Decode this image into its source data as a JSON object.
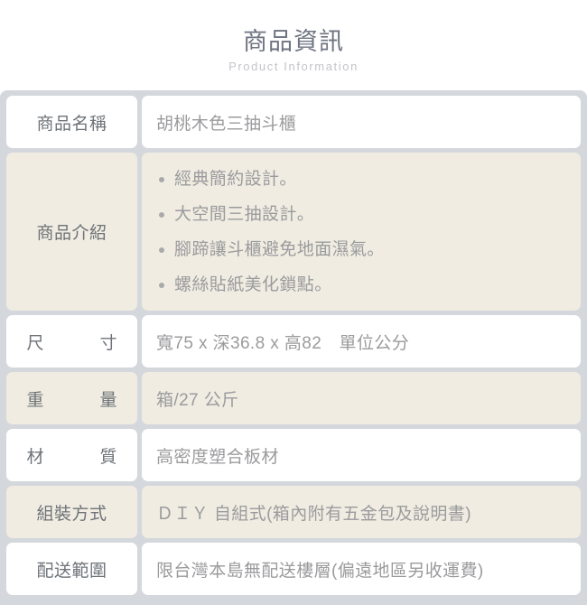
{
  "header": {
    "title": "商品資訊",
    "subtitle": "Product Information"
  },
  "colors": {
    "panel_background": "#d4d8dd",
    "cell_white": "#ffffff",
    "cell_beige": "#f0ece1",
    "label_text": "#6e7378",
    "value_text": "#9b9b9e",
    "title_text": "#6e7380",
    "subtitle_text": "#c3c4c9",
    "bullet": "#a9a9ac"
  },
  "table": {
    "rows": [
      {
        "label": "商品名稱",
        "value": "胡桃木色三抽斗櫃",
        "fill": "white",
        "label_spaced": false,
        "type": "text"
      },
      {
        "label": "商品介紹",
        "fill": "beige",
        "label_spaced": false,
        "type": "bullets",
        "bullets": [
          "經典簡約設計。",
          "大空間三抽設計。",
          "腳蹄讓斗櫃避免地面濕氣。",
          "螺絲貼紙美化鎖點。"
        ]
      },
      {
        "label": "尺寸",
        "value": "寬75 x 深36.8 x 高82　單位公分",
        "fill": "white",
        "label_spaced": true,
        "type": "text"
      },
      {
        "label": "重量",
        "value": "箱/27 公斤",
        "fill": "beige",
        "label_spaced": true,
        "type": "text"
      },
      {
        "label": "材質",
        "value": "高密度塑合板材",
        "fill": "white",
        "label_spaced": true,
        "type": "text"
      },
      {
        "label": "組裝方式",
        "value": "ＤＩＹ 自組式(箱內附有五金包及說明書)",
        "fill": "beige",
        "label_spaced": false,
        "type": "text"
      },
      {
        "label": "配送範圍",
        "value": "限台灣本島無配送樓層(偏遠地區另收運費)",
        "fill": "white",
        "label_spaced": false,
        "type": "text"
      }
    ]
  }
}
